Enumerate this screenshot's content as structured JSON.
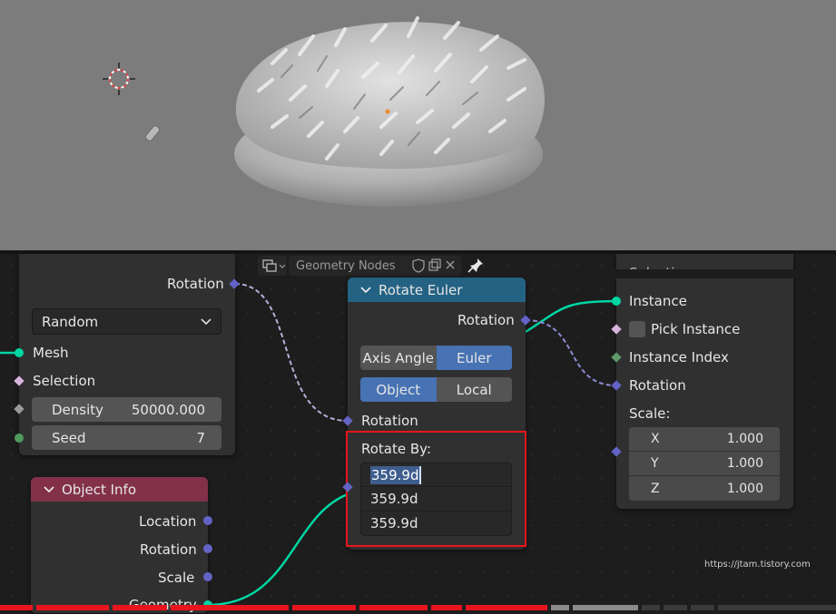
{
  "header": {
    "editor_name": "Geometry Nodes",
    "icons": [
      "editor-type-icon",
      "shield-icon",
      "copy-icon",
      "close-icon",
      "pin-icon"
    ]
  },
  "distribute_node": {
    "rotation_label": "Rotation",
    "mode_value": "Random",
    "mesh_label": "Mesh",
    "selection_label": "Selection",
    "density_label": "Density",
    "density_value": "50000.000",
    "seed_label": "Seed",
    "seed_value": "7"
  },
  "object_info_node": {
    "title": "Object Info",
    "location_label": "Location",
    "rotation_label": "Rotation",
    "scale_label": "Scale",
    "geometry_label": "Geometry"
  },
  "rotate_euler_node": {
    "title": "Rotate Euler",
    "rotation_out_label": "Rotation",
    "type_options": [
      "Axis Angle",
      "Euler"
    ],
    "type_selected": "Euler",
    "space_options": [
      "Object",
      "Local"
    ],
    "space_selected": "Object",
    "rotation_in_label": "Rotation",
    "rotate_by_label": "Rotate By:",
    "rotate_by_values": [
      "359.9d",
      "359.9d",
      "359.9d"
    ]
  },
  "instance_node": {
    "partial_top_label": "Selection",
    "instance_label": "Instance",
    "pick_instance_label": "Pick Instance",
    "instance_index_label": "Instance Index",
    "rotation_label": "Rotation",
    "scale_label": "Scale:",
    "scale": [
      {
        "axis": "X",
        "value": "1.000"
      },
      {
        "axis": "Y",
        "value": "1.000"
      },
      {
        "axis": "Z",
        "value": "1.000"
      }
    ]
  },
  "watermark": "https://jtam.tistory.com",
  "colors": {
    "viewport_bg": "#7c7c7c",
    "editor_bg": "#1d1d1d",
    "node_bg": "#303030",
    "rotate_euler_header": "#246283",
    "object_info_header": "#83314a",
    "geometry_socket": "#00d6a3",
    "vector_socket": "#6363c7",
    "float_socket": "#a1a1a1",
    "highlight_red": "#e8141e",
    "button_selected": "#4772b3"
  }
}
